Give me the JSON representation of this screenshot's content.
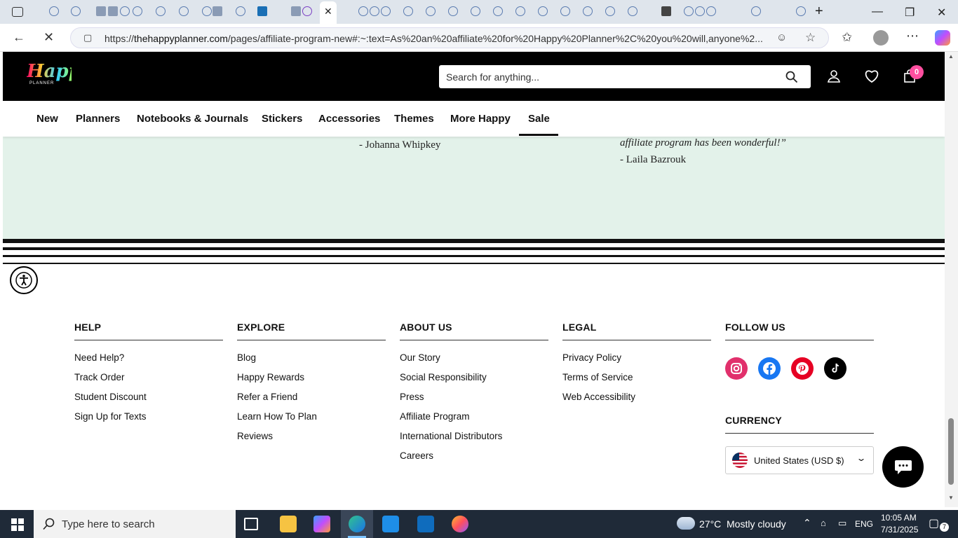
{
  "browser": {
    "url_domain": "thehappyplanner.com",
    "url_prefix": "https://",
    "url_rest": "/pages/affiliate-program-new#:~:text=As%20an%20affiliate%20for%20Happy%20Planner%2C%20you%20will,anyone%2..."
  },
  "header": {
    "logo_text": "Happy",
    "logo_sub": "PLANNER",
    "search_placeholder": "Search for anything...",
    "cart_count": "0"
  },
  "nav": {
    "items": [
      "New",
      "Planners",
      "Notebooks & Journals",
      "Stickers",
      "Accessories",
      "Themes",
      "More Happy",
      "Sale"
    ]
  },
  "testimonials": {
    "author_1": "- Johanna Whipkey",
    "quote_2_tail": "affiliate program has been wonderful!”",
    "author_2": "- Laila Bazrouk"
  },
  "footer": {
    "columns": [
      {
        "heading": "HELP",
        "links": [
          "Need Help?",
          "Track Order",
          "Student Discount",
          "Sign Up for Texts"
        ]
      },
      {
        "heading": "EXPLORE",
        "links": [
          "Blog",
          "Happy Rewards",
          "Refer a Friend",
          "Learn How To Plan",
          "Reviews"
        ]
      },
      {
        "heading": "ABOUT US",
        "links": [
          "Our Story",
          "Social Responsibility",
          "Press",
          "Affiliate Program",
          "International Distributors",
          "Careers"
        ]
      },
      {
        "heading": "LEGAL",
        "links": [
          "Privacy Policy",
          "Terms of Service",
          "Web Accessibility"
        ]
      }
    ],
    "follow_heading": "FOLLOW US",
    "currency_heading": "CURRENCY",
    "currency_value": "United States (USD $)"
  },
  "taskbar": {
    "search_placeholder": "Type here to search",
    "weather_temp": "27°C",
    "weather_desc": "Mostly cloudy",
    "lang": "ENG",
    "time": "10:05 AM",
    "date": "7/31/2025",
    "notif_count": "7"
  },
  "colors": {
    "header_bg": "#000000",
    "testimonial_bg": "#e3f2ea",
    "cart_badge": "#ff4fa0",
    "instagram": "#e1306c",
    "facebook": "#1877f2",
    "pinterest": "#e60023",
    "tiktok": "#000000",
    "taskbar": "#1f2a38"
  }
}
